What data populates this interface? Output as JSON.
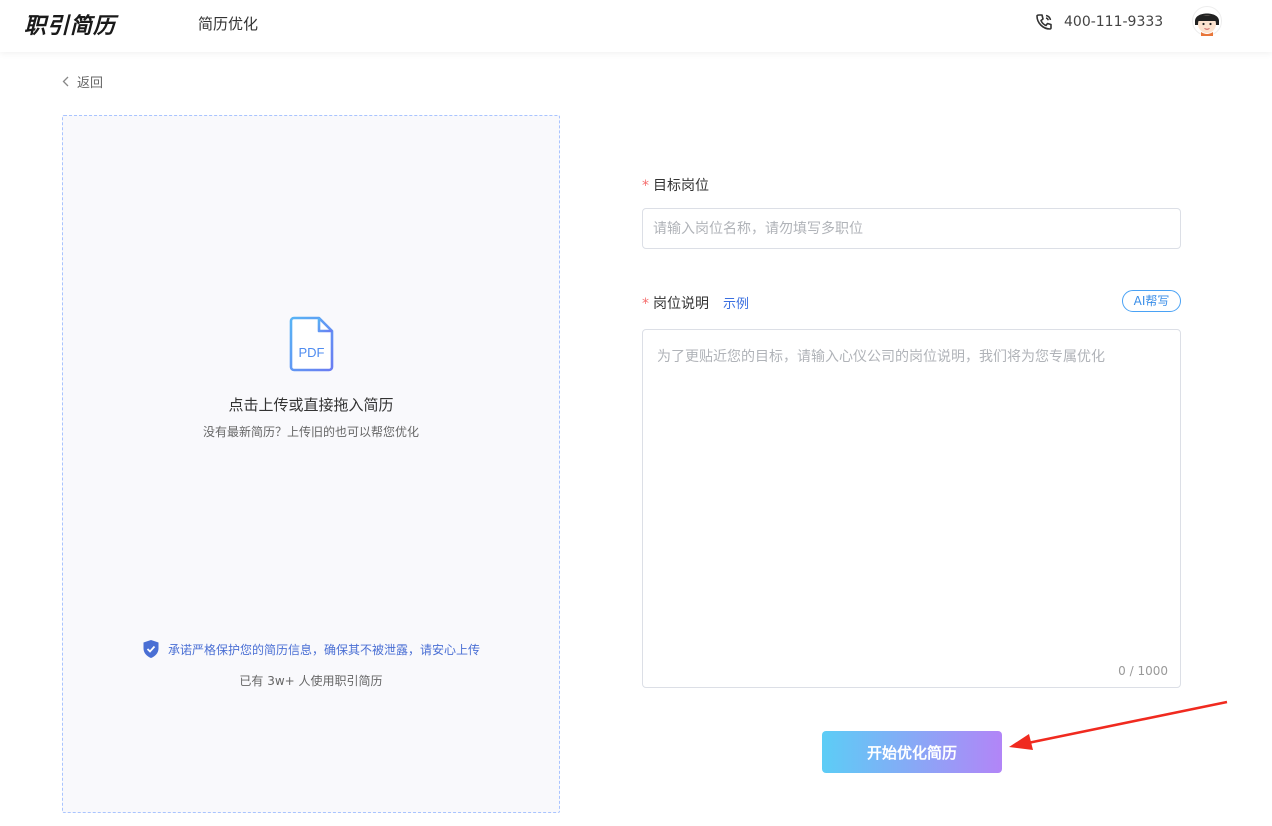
{
  "header": {
    "logo": "职引简历",
    "nav_item": "简历优化",
    "phone": "400-111-9333",
    "icons": {
      "phone": "phone-icon",
      "avatar": "avatar"
    }
  },
  "back": {
    "label": "返回"
  },
  "upload": {
    "icon_text": "PDF",
    "title": "点击上传或直接拖入简历",
    "subtitle": "没有最新简历？上传旧的也可以帮您优化",
    "privacy": "承诺严格保护您的简历信息，确保其不被泄露，请安心上传",
    "users": "已有 3w+ 人使用职引简历"
  },
  "form": {
    "required_mark": "*",
    "target_label": "目标岗位",
    "target_placeholder": "请输入岗位名称，请勿填写多职位",
    "desc_label": "岗位说明",
    "example_link": "示例",
    "ai_button": "AI帮写",
    "desc_placeholder": "为了更贴近您的目标，请输入心仪公司的岗位说明，我们将为您专属优化",
    "counter": "0 / 1000",
    "submit": "开始优化简历"
  },
  "colors": {
    "accent": "#3a6fe0",
    "required": "#f56c6c",
    "button_gradient_start": "#5ccdf6",
    "button_gradient_end": "#b285f7",
    "annotation_arrow": "#f02a1f"
  }
}
